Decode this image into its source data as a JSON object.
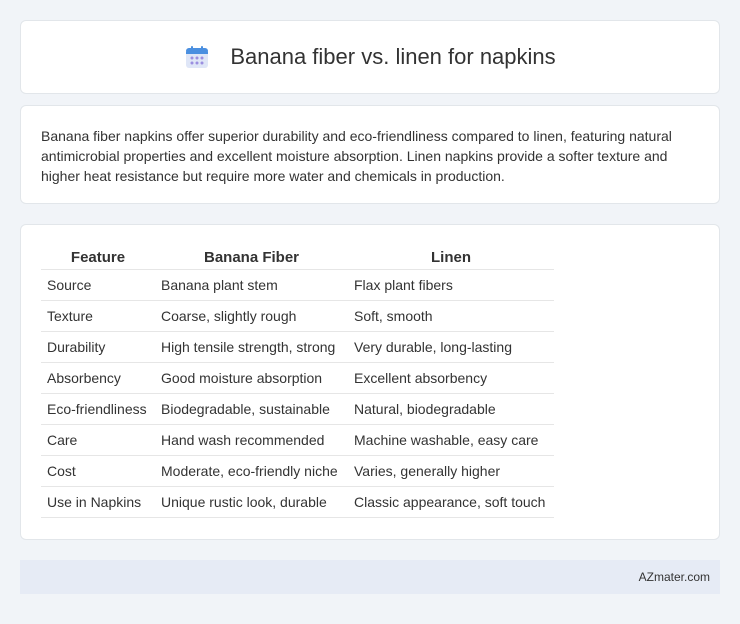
{
  "header": {
    "title": "Banana fiber vs. linen for napkins",
    "icon": "calendar-icon"
  },
  "summary": {
    "text": "Banana fiber napkins offer superior durability and eco-friendliness compared to linen, featuring natural antimicrobial properties and excellent moisture absorption. Linen napkins provide a softer texture and higher heat resistance but require more water and chemicals in production."
  },
  "table": {
    "headers": [
      "Feature",
      "Banana Fiber",
      "Linen"
    ],
    "rows": [
      [
        "Source",
        "Banana plant stem",
        "Flax plant fibers"
      ],
      [
        "Texture",
        "Coarse, slightly rough",
        "Soft, smooth"
      ],
      [
        "Durability",
        "High tensile strength, strong",
        "Very durable, long-lasting"
      ],
      [
        "Absorbency",
        "Good moisture absorption",
        "Excellent absorbency"
      ],
      [
        "Eco-friendliness",
        "Biodegradable, sustainable",
        "Natural, biodegradable"
      ],
      [
        "Care",
        "Hand wash recommended",
        "Machine washable, easy care"
      ],
      [
        "Cost",
        "Moderate, eco-friendly niche",
        "Varies, generally higher"
      ],
      [
        "Use in Napkins",
        "Unique rustic look, durable",
        "Classic appearance, soft touch"
      ]
    ]
  },
  "footer": {
    "brand": "AZmater.com"
  },
  "colors": {
    "background": "#f1f4f8",
    "card": "#ffffff",
    "footer": "#e6ebf5",
    "icon_top": "#4a8fe0",
    "icon_body": "#dfe6f7",
    "icon_dots": "#9b8fe0"
  }
}
